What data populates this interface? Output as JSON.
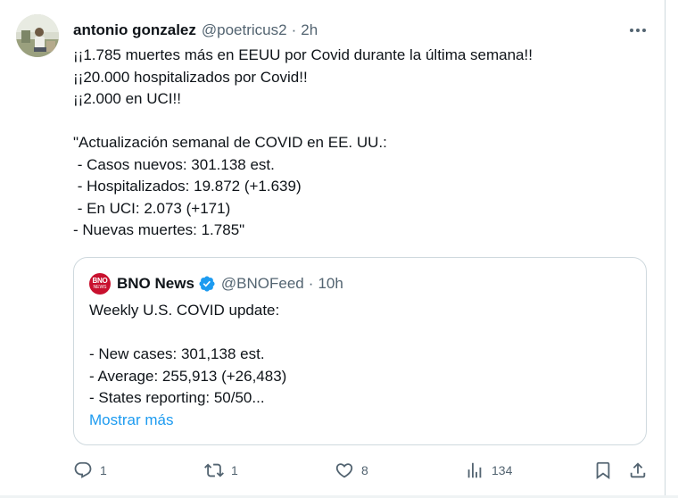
{
  "tweet": {
    "author_name": "antonio gonzalez",
    "author_handle": "@poetricus2",
    "separator": "·",
    "time": "2h",
    "more_icon": "more-horizontal-icon",
    "lines": [
      "¡¡1.785 muertes más en EEUU por Covid durante la última semana!!",
      "¡¡20.000 hospitalizados por Covid!!",
      "¡¡2.000 en UCI!!",
      "",
      "\"Actualización semanal de COVID en EE. UU.:",
      " - Casos nuevos: 301.138 est.",
      " - Hospitalizados: 19.872 (+1.639)",
      " - En UCI: 2.073 (+171)",
      "- Nuevas muertes: 1.785\""
    ]
  },
  "quote": {
    "logo_line1": "BNO",
    "logo_line2": "NEWS",
    "author_name": "BNO News",
    "author_handle": "@BNOFeed",
    "separator": "·",
    "time": "10h",
    "verified_color": "#1d9bf0",
    "lines": [
      "Weekly U.S. COVID update:",
      "",
      "- New cases: 301,138 est.",
      "- Average: 255,913 (+26,483)",
      "- States reporting: 50/50..."
    ],
    "show_more": "Mostrar más"
  },
  "actions": {
    "replies": "1",
    "retweets": "1",
    "likes": "8",
    "views": "134"
  },
  "colors": {
    "text": "#0f1419",
    "secondary": "#536471",
    "accent": "#1d9bf0",
    "border": "#cfd9de",
    "bno_red": "#c8102e"
  }
}
